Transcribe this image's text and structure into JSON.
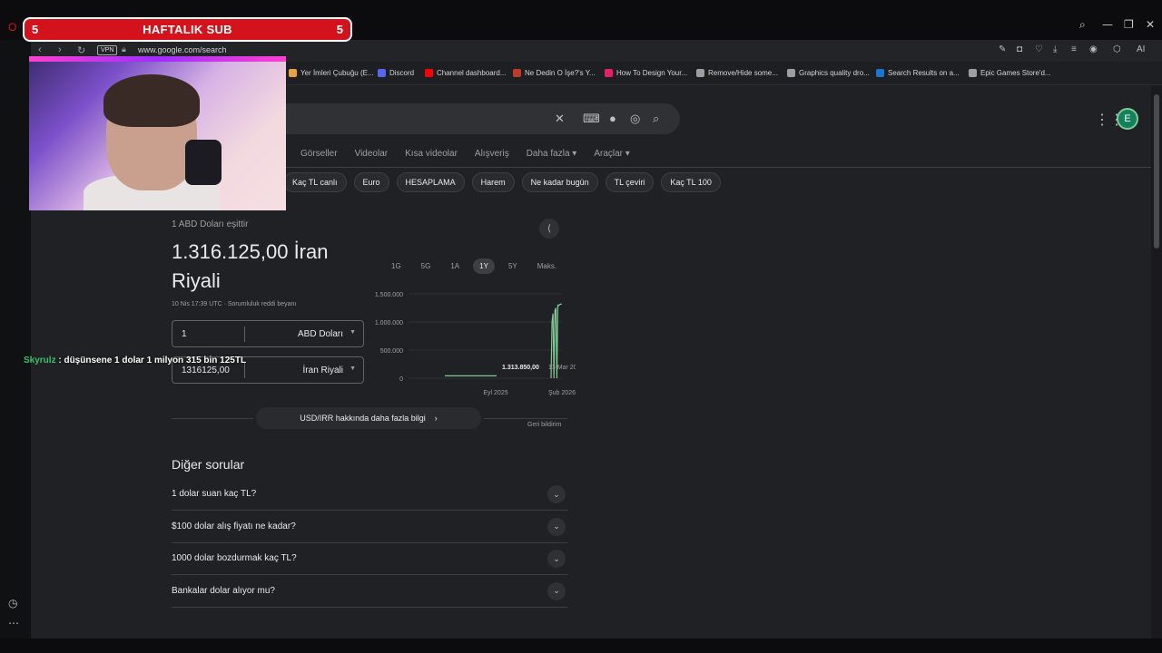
{
  "banner": {
    "left_count": "5",
    "title": "HAFTALIK SUB",
    "right_count": "5"
  },
  "browser": {
    "vpn": "VPN",
    "url": "www.google.com/search",
    "window_controls": {
      "search": "⌕",
      "minimize": "—",
      "restore": "❐",
      "close": "✕"
    },
    "ai_label": "AI"
  },
  "bookmarks": [
    {
      "label": "Yer İmleri Çubuğu (E...",
      "color": "#e8a33d"
    },
    {
      "label": "Discord",
      "color": "#5865f2"
    },
    {
      "label": "Channel dashboard...",
      "color": "#ff0000"
    },
    {
      "label": "Ne Dedin O İşe?'s Y...",
      "color": "#c0392b"
    },
    {
      "label": "How To Design Your...",
      "color": "#e91e63"
    },
    {
      "label": "Remove/Hide some...",
      "color": "#9e9e9e"
    },
    {
      "label": "Graphics quality dro...",
      "color": "#9e9e9e"
    },
    {
      "label": "Search Results on a...",
      "color": "#1976d2"
    },
    {
      "label": "Epic Games Store'd...",
      "color": "#9e9e9e"
    }
  ],
  "google": {
    "avatar_letter": "E",
    "tabs": [
      "Görseller",
      "Videolar",
      "Kısa videolar",
      "Alışveriş",
      "Daha fazla ▾",
      "Araçlar ▾"
    ],
    "chips": [
      "Kaç TL canlı",
      "Euro",
      "HESAPLAMA",
      "Harem",
      "Ne kadar bugün",
      "TL çeviri",
      "Kaç TL 100"
    ]
  },
  "converter": {
    "label": "1 ABD Doları eşittir",
    "value": "1.316.125,00 İran Riyali",
    "note": "10 Nis 17:39 UTC · Sorumluluk reddi beyanı",
    "from_amount": "1",
    "from_currency": "ABD Doları",
    "to_amount": "1316125,00",
    "to_currency": "İran Riyali",
    "more_info": "USD/IRR hakkında daha fazla bilgi",
    "feedback": "Geri bildirim"
  },
  "ranges": {
    "items": [
      "1G",
      "5G",
      "1A",
      "1Y",
      "5Y",
      "Maks."
    ],
    "active": "1Y"
  },
  "chart_data": {
    "type": "line",
    "title": "",
    "xlabel": "",
    "ylabel": "",
    "ylim": [
      0,
      1500000
    ],
    "y_ticks": [
      "0",
      "500.000",
      "1.000.000",
      "1.500.000"
    ],
    "x_ticks": [
      "Eyl 2025",
      "Şub 2026"
    ],
    "series": [
      {
        "values": [
          42000,
          42000,
          42000,
          42000,
          42000,
          42000,
          42000,
          42000,
          42000,
          42000,
          42000,
          42000,
          42000,
          42000,
          42000,
          42000,
          42000,
          0,
          1000000,
          1150000,
          0,
          1200000,
          1250000,
          0,
          1300000,
          1290000,
          1313850,
          1316125,
          1316125
        ]
      }
    ],
    "tooltip": {
      "value": "1.313.850,00",
      "date": "13 Mar 2026"
    },
    "line_color": "#81c995"
  },
  "people_also_ask": {
    "title": "Diğer sorular",
    "items": [
      "1 dolar suan kaç TL?",
      "$100 dolar alış fiyatı ne kadar?",
      "1000 dolar bozdurmak kaç TL?",
      "Bankalar dolar alıyor mu?"
    ]
  },
  "chat": {
    "user": "Skyrulz",
    "message": ": düşünsene 1 dolar 1 milyon 315 bin 125TL"
  }
}
